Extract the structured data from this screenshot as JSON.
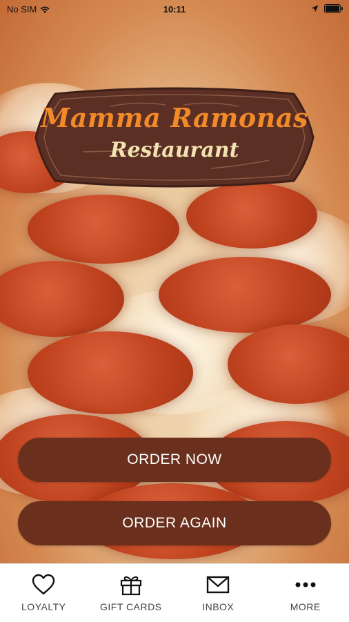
{
  "status": {
    "carrier": "No SIM",
    "time": "10:11",
    "wifi_icon": "wifi-icon",
    "location_icon": "location-arrow-icon",
    "battery_icon": "battery-icon"
  },
  "logo": {
    "title": "Mamma Ramonas",
    "subtitle": "Restaurant",
    "colors": {
      "plate": "#5b2f24",
      "title": "#f28a2a",
      "subtitle": "#f4e3b2"
    }
  },
  "actions": {
    "order_now": "ORDER NOW",
    "order_again": "ORDER AGAIN",
    "button_color": "#6a2f1d"
  },
  "tabs": [
    {
      "label": "LOYALTY",
      "icon": "heart-icon"
    },
    {
      "label": "GIFT CARDS",
      "icon": "gift-icon"
    },
    {
      "label": "INBOX",
      "icon": "envelope-icon"
    },
    {
      "label": "MORE",
      "icon": "more-dots-icon"
    }
  ]
}
